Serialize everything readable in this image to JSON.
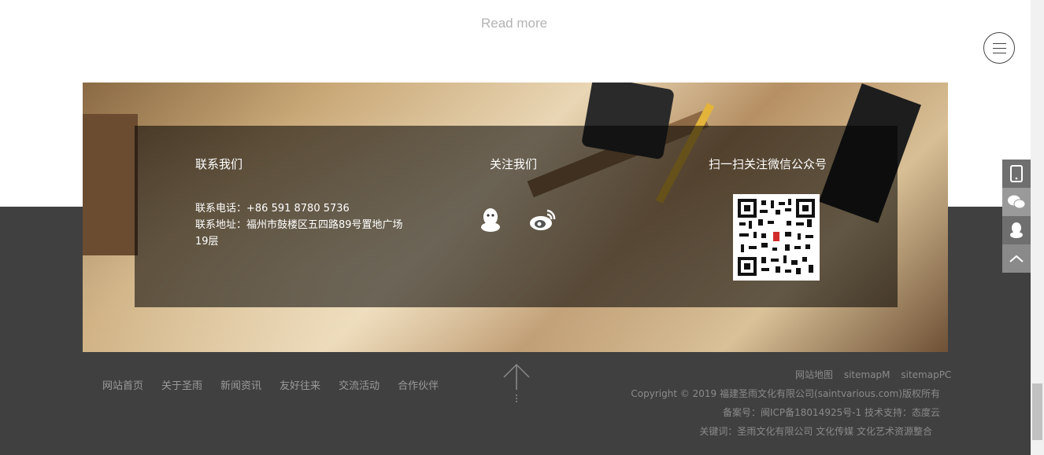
{
  "read_more": "Read more",
  "contact": {
    "title": "联系我们",
    "phone": "联系电话：+86 591 8780 5736",
    "address": "联系地址：福州市鼓楼区五四路89号置地广场19层"
  },
  "follow": {
    "title": "关注我们",
    "qq_icon": "qq-icon",
    "weibo_icon": "weibo-icon"
  },
  "wechat": {
    "title": "扫一扫关注微信公众号"
  },
  "nav": [
    "网站首页",
    "关于圣雨",
    "新闻资讯",
    "友好往来",
    "交流活动",
    "合作伙伴"
  ],
  "sitemap": [
    "网站地图",
    "sitemapM",
    "sitemapPC"
  ],
  "footer": {
    "copyright": "Copyright © 2019 福建圣雨文化有限公司(saintvarious.com)版权所有",
    "icp": "备案号：闽ICP备18014925号-1   技术支持：态度云",
    "keywords": "关键词：圣雨文化有限公司 文化传媒 文化艺术资源整合"
  },
  "side_tools": [
    "phone-icon",
    "wechat-icon",
    "qq-icon",
    "back-to-top-icon"
  ],
  "colors": {
    "footer_bg": "#404040",
    "panel_overlay": "rgba(0,0,0,0.55)",
    "nav_text": "#9a9a9a"
  }
}
